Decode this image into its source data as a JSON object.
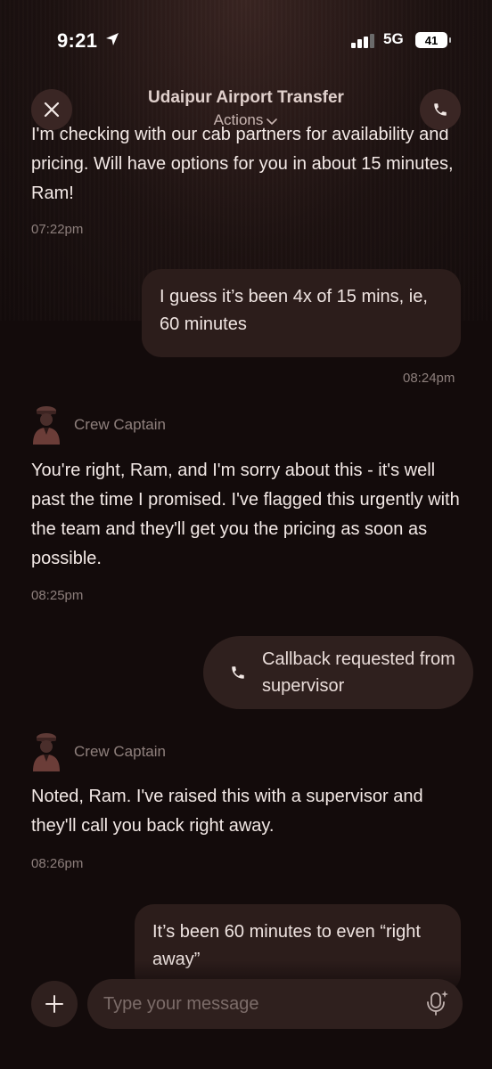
{
  "status_bar": {
    "time": "9:21",
    "network": "5G",
    "battery": "41"
  },
  "header": {
    "title": "Udaipur Airport Transfer",
    "actions_label": "Actions"
  },
  "messages": {
    "m1": {
      "text": "I'm checking with our cab partners for availability and pricing. Will have options for you in about 15 minutes, Ram!",
      "time": "07:22pm"
    },
    "m2": {
      "text": "I guess it’s been 4x of 15 mins, ie, 60 minutes",
      "time": "08:24pm"
    },
    "m3": {
      "sender": "Crew Captain",
      "text": "You're right, Ram, and I'm sorry about this - it's well past the time I promised. I've flagged this urgently with the team and they'll get you the pricing as soon as possible.",
      "time": "08:25pm"
    },
    "callback": {
      "text": "Callback requested from supervisor"
    },
    "m4": {
      "sender": "Crew Captain",
      "text": "Noted, Ram. I've raised this with a supervisor and they'll call you back right away.",
      "time": "08:26pm"
    },
    "m5": {
      "text": "It’s been 60 minutes to even “right away”"
    }
  },
  "composer": {
    "placeholder": "Type your message"
  },
  "icons": {
    "close": "close-icon",
    "phone": "phone-icon",
    "chevron": "chevron-down-icon",
    "plus": "plus-icon",
    "mic": "mic-sparkle-icon",
    "avatar": "crew-captain-avatar"
  },
  "colors": {
    "background": "#130b0b",
    "bubble": "#2c1d1b",
    "button": "#3a2624",
    "muted_text": "#8d7f7c"
  }
}
